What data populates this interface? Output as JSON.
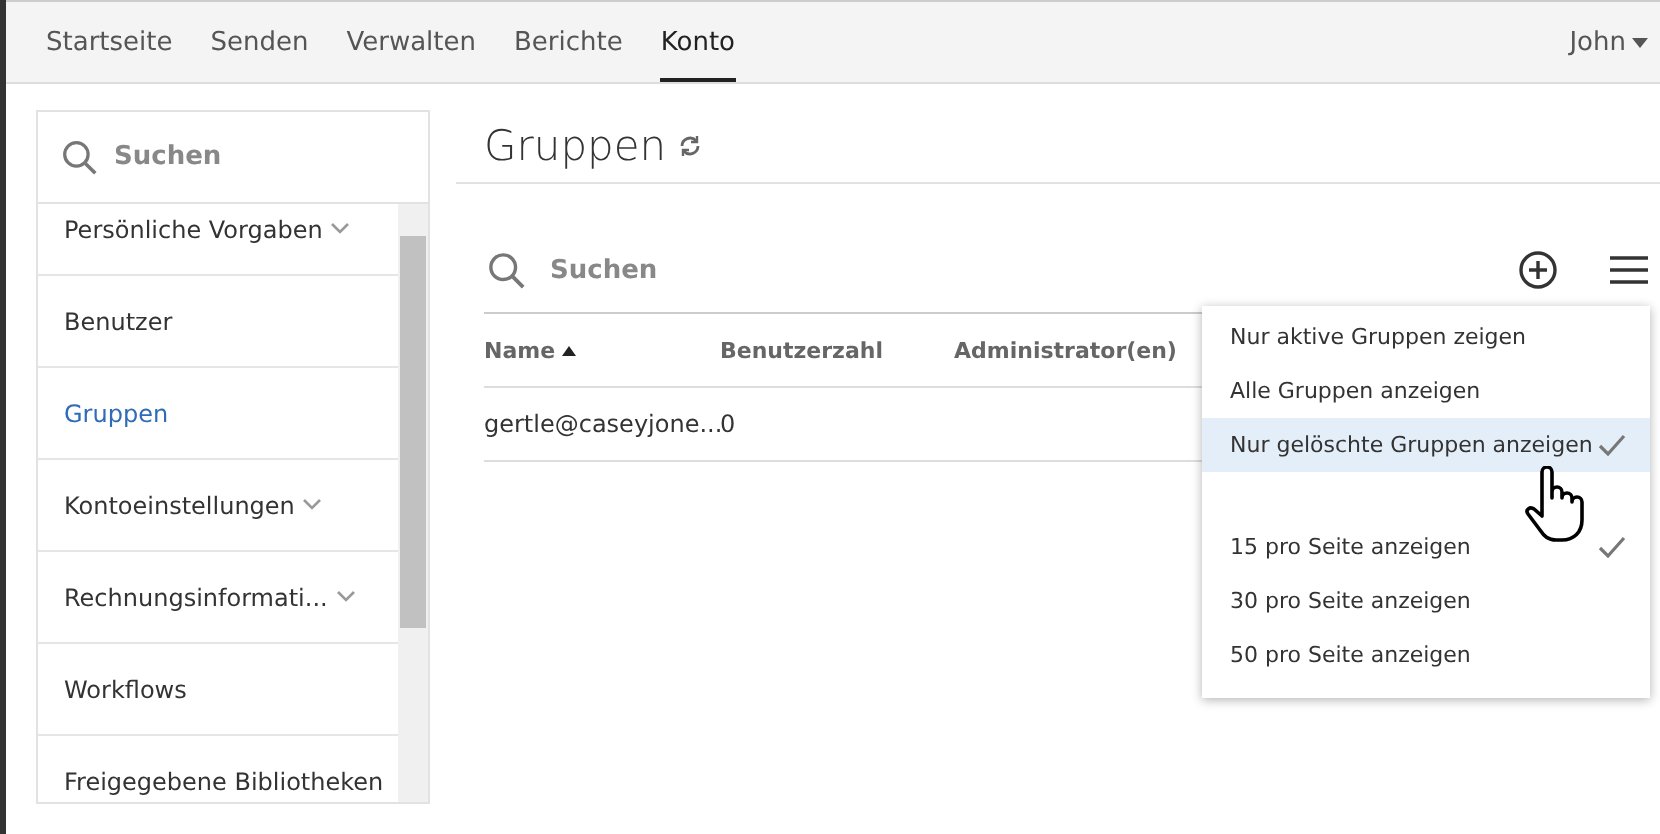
{
  "nav": {
    "tabs": [
      {
        "label": "Startseite",
        "selected": false
      },
      {
        "label": "Senden",
        "selected": false
      },
      {
        "label": "Verwalten",
        "selected": false
      },
      {
        "label": "Berichte",
        "selected": false
      },
      {
        "label": "Konto",
        "selected": true
      }
    ],
    "user": "John"
  },
  "sidebar": {
    "search_placeholder": "Suchen",
    "items": [
      {
        "label": "Persönliche Vorgaben",
        "expandable": true,
        "selected": false
      },
      {
        "label": "Benutzer",
        "expandable": false,
        "selected": false
      },
      {
        "label": "Gruppen",
        "expandable": false,
        "selected": true
      },
      {
        "label": "Kontoeinstellungen",
        "expandable": true,
        "selected": false
      },
      {
        "label": "Rechnungsinformati...",
        "expandable": true,
        "selected": false
      },
      {
        "label": "Workflows",
        "expandable": false,
        "selected": false
      },
      {
        "label": "Freigegebene Bibliotheken",
        "expandable": false,
        "selected": false
      }
    ]
  },
  "page": {
    "title": "Gruppen",
    "search_placeholder": "Suchen"
  },
  "table": {
    "columns": [
      {
        "label": "Name",
        "sorted": true
      },
      {
        "label": "Benutzerzahl",
        "sorted": false
      },
      {
        "label": "Administrator(en)",
        "sorted": false
      }
    ],
    "rows": [
      [
        "gertle@caseyjone...",
        "0",
        ""
      ]
    ]
  },
  "menu": {
    "groups": [
      [
        {
          "label": "Nur aktive Gruppen zeigen",
          "checked": false,
          "highlighted": false
        },
        {
          "label": "Alle Gruppen anzeigen",
          "checked": false,
          "highlighted": false
        },
        {
          "label": "Nur gelöschte Gruppen anzeigen",
          "checked": true,
          "highlighted": true
        }
      ],
      [
        {
          "label": "15 pro Seite anzeigen",
          "checked": true,
          "highlighted": false
        },
        {
          "label": "30 pro Seite anzeigen",
          "checked": false,
          "highlighted": false
        },
        {
          "label": "50 pro Seite anzeigen",
          "checked": false,
          "highlighted": false
        }
      ]
    ]
  }
}
